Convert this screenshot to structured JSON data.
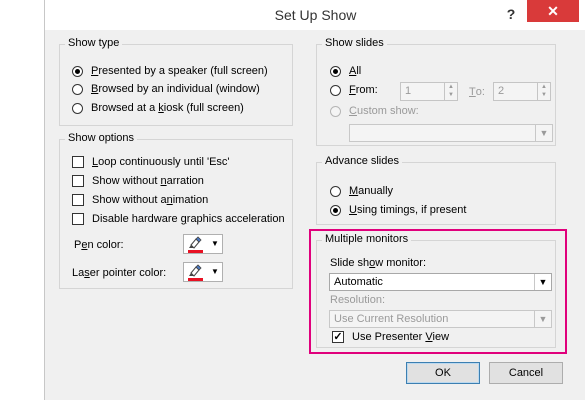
{
  "dialog": {
    "title": "Set Up Show",
    "help": "?",
    "close": "✕"
  },
  "show_type": {
    "legend": "Show type",
    "options": [
      {
        "pre": "",
        "key": "P",
        "post": "resented by a speaker (full screen)",
        "selected": true
      },
      {
        "pre": "",
        "key": "B",
        "post": "rowsed by an individual (window)",
        "selected": false
      },
      {
        "pre": "Browsed at a ",
        "key": "k",
        "post": "iosk (full screen)",
        "selected": false
      }
    ]
  },
  "show_options": {
    "legend": "Show options",
    "checks": [
      {
        "pre": "",
        "key": "L",
        "post": "oop continuously until 'Esc'",
        "checked": false
      },
      {
        "pre": "Show without ",
        "key": "n",
        "post": "arration",
        "checked": false
      },
      {
        "pre": "Show without a",
        "key": "n",
        "post": "imation",
        "checked": false
      },
      {
        "pre": "Disable hardware ",
        "key": "g",
        "post": "raphics acceleration",
        "checked": false
      }
    ],
    "pen_color": {
      "pre": "P",
      "key": "e",
      "post": "n color:"
    },
    "laser_color": {
      "pre": "La",
      "key": "s",
      "post": "er pointer color:"
    },
    "pen_icon": "pen-color-icon",
    "swatch_color": "#e81123"
  },
  "show_slides": {
    "legend": "Show slides",
    "all": {
      "key": "A",
      "post": "ll",
      "selected": true
    },
    "from": {
      "key": "F",
      "post": "rom:",
      "selected": false,
      "from_value": "1"
    },
    "to": {
      "key": "T",
      "post": "o:",
      "to_value": "2"
    },
    "custom": {
      "key": "C",
      "post": "ustom show:"
    }
  },
  "advance_slides": {
    "legend": "Advance slides",
    "manually": {
      "key": "M",
      "post": "anually",
      "selected": false
    },
    "timings": {
      "key": "U",
      "post": "sing timings, if present",
      "selected": true
    }
  },
  "multiple_monitors": {
    "legend": "Multiple monitors",
    "monitor_label": {
      "pre": "Slide sh",
      "key": "o",
      "post": "w monitor:"
    },
    "monitor_value": "Automatic",
    "resolution_label": "Resolution:",
    "resolution_value": "Use Current Resolution",
    "presenter": {
      "pre": "Use Presenter ",
      "key": "V",
      "post": "iew",
      "checked": true
    },
    "highlight_color": "#e0007c"
  },
  "buttons": {
    "ok": "OK",
    "cancel": "Cancel"
  }
}
